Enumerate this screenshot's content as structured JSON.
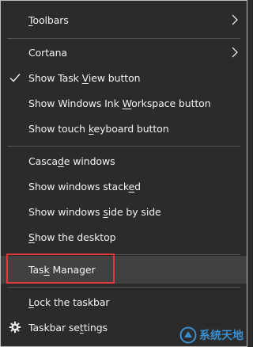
{
  "menu": {
    "items": [
      {
        "pre": "",
        "u": "T",
        "post": "oolbars"
      },
      {
        "pre": "",
        "u": "",
        "post": "Cortana"
      },
      {
        "pre": "Show Task ",
        "u": "V",
        "post": "iew button"
      },
      {
        "pre": "Show Windows Ink ",
        "u": "W",
        "post": "orkspace button"
      },
      {
        "pre": "Show touch ",
        "u": "k",
        "post": "eyboard button"
      },
      {
        "pre": "Casca",
        "u": "d",
        "post": "e windows"
      },
      {
        "pre": "Show windows stack",
        "u": "e",
        "post": "d"
      },
      {
        "pre": "Show windows ",
        "u": "s",
        "post": "ide by side"
      },
      {
        "pre": "",
        "u": "S",
        "post": "how the desktop"
      },
      {
        "pre": "Tas",
        "u": "k",
        "post": " Manager"
      },
      {
        "pre": "",
        "u": "L",
        "post": "ock the taskbar"
      },
      {
        "pre": "Taskbar se",
        "u": "t",
        "post": "tings"
      }
    ]
  },
  "icons": {
    "toolbars": "chevron-right-icon",
    "cortana": "chevron-right-icon",
    "task_view": "checkmark-icon",
    "settings": "gear-icon"
  },
  "watermark": {
    "text": "系统天地"
  },
  "colors": {
    "menu_bg": "#2b2b2b",
    "highlight": "#414141",
    "annotation": "#e0393e",
    "watermark": "#3a8fd0"
  }
}
